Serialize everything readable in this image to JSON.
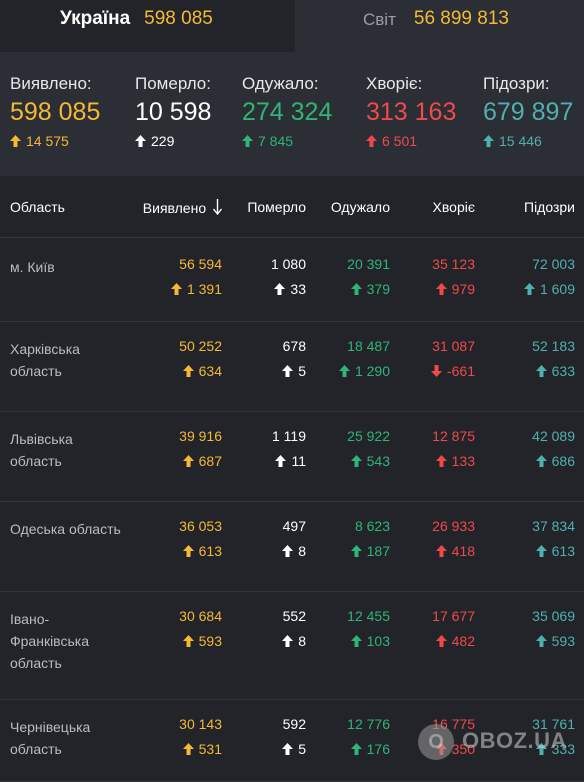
{
  "tabs": {
    "ukraine": {
      "label": "Україна",
      "value": "598 085"
    },
    "world": {
      "label": "Світ",
      "value": "56 899 813"
    }
  },
  "summary": [
    {
      "label": "Виявлено:",
      "value": "598 085",
      "delta": "14 575",
      "color": "#f5b935",
      "direction": "up"
    },
    {
      "label": "Померло:",
      "value": "10 598",
      "delta": "229",
      "color": "#ffffff",
      "direction": "up"
    },
    {
      "label": "Одужало:",
      "value": "274 324",
      "delta": "7 845",
      "color": "#2fb578",
      "direction": "up"
    },
    {
      "label": "Хворіє:",
      "value": "313 163",
      "delta": "6 501",
      "color": "#f0494c",
      "direction": "up"
    },
    {
      "label": "Підозри:",
      "value": "679 897",
      "delta": "15 446",
      "color": "#4fb0b0",
      "direction": "up"
    }
  ],
  "table": {
    "headers": {
      "region": "Область",
      "detected": "Виявлено",
      "sort_icon": "arrow-down-icon",
      "died": "Померло",
      "recovered": "Одужало",
      "sick": "Хворіє",
      "suspected": "Підозри"
    },
    "rows": [
      {
        "region": "м. Київ",
        "detected": "56 594",
        "detected_delta": "1 391",
        "detected_dir": "up",
        "died": "1 080",
        "died_delta": "33",
        "died_dir": "up",
        "recovered": "20 391",
        "recovered_delta": "379",
        "recovered_dir": "up",
        "sick": "35 123",
        "sick_delta": "979",
        "sick_dir": "up",
        "suspected": "72 003",
        "suspected_delta": "1 609",
        "suspected_dir": "up"
      },
      {
        "region": "Харківська область",
        "detected": "50 252",
        "detected_delta": "634",
        "detected_dir": "up",
        "died": "678",
        "died_delta": "5",
        "died_dir": "up",
        "recovered": "18 487",
        "recovered_delta": "1 290",
        "recovered_dir": "up",
        "sick": "31 087",
        "sick_delta": "-661",
        "sick_dir": "down",
        "suspected": "52 183",
        "suspected_delta": "633",
        "suspected_dir": "up"
      },
      {
        "region": "Львівська область",
        "detected": "39 916",
        "detected_delta": "687",
        "detected_dir": "up",
        "died": "1 119",
        "died_delta": "11",
        "died_dir": "up",
        "recovered": "25 922",
        "recovered_delta": "543",
        "recovered_dir": "up",
        "sick": "12 875",
        "sick_delta": "133",
        "sick_dir": "up",
        "suspected": "42 089",
        "suspected_delta": "686",
        "suspected_dir": "up"
      },
      {
        "region": "Одеська область",
        "detected": "36 053",
        "detected_delta": "613",
        "detected_dir": "up",
        "died": "497",
        "died_delta": "8",
        "died_dir": "up",
        "recovered": "8 623",
        "recovered_delta": "187",
        "recovered_dir": "up",
        "sick": "26 933",
        "sick_delta": "418",
        "sick_dir": "up",
        "suspected": "37 834",
        "suspected_delta": "613",
        "suspected_dir": "up"
      },
      {
        "region": "Івано-Франківська область",
        "detected": "30 684",
        "detected_delta": "593",
        "detected_dir": "up",
        "died": "552",
        "died_delta": "8",
        "died_dir": "up",
        "recovered": "12 455",
        "recovered_delta": "103",
        "recovered_dir": "up",
        "sick": "17 677",
        "sick_delta": "482",
        "sick_dir": "up",
        "suspected": "35 069",
        "suspected_delta": "593",
        "suspected_dir": "up"
      },
      {
        "region": "Чернівецька область",
        "detected": "30 143",
        "detected_delta": "531",
        "detected_dir": "up",
        "died": "592",
        "died_delta": "5",
        "died_dir": "up",
        "recovered": "12 776",
        "recovered_delta": "176",
        "recovered_dir": "up",
        "sick": "16 775",
        "sick_delta": "350",
        "sick_dir": "up",
        "suspected": "31 761",
        "suspected_delta": "333",
        "suspected_dir": "up"
      }
    ]
  },
  "watermark": {
    "logo": "O",
    "text": "OBOZ.UA"
  }
}
